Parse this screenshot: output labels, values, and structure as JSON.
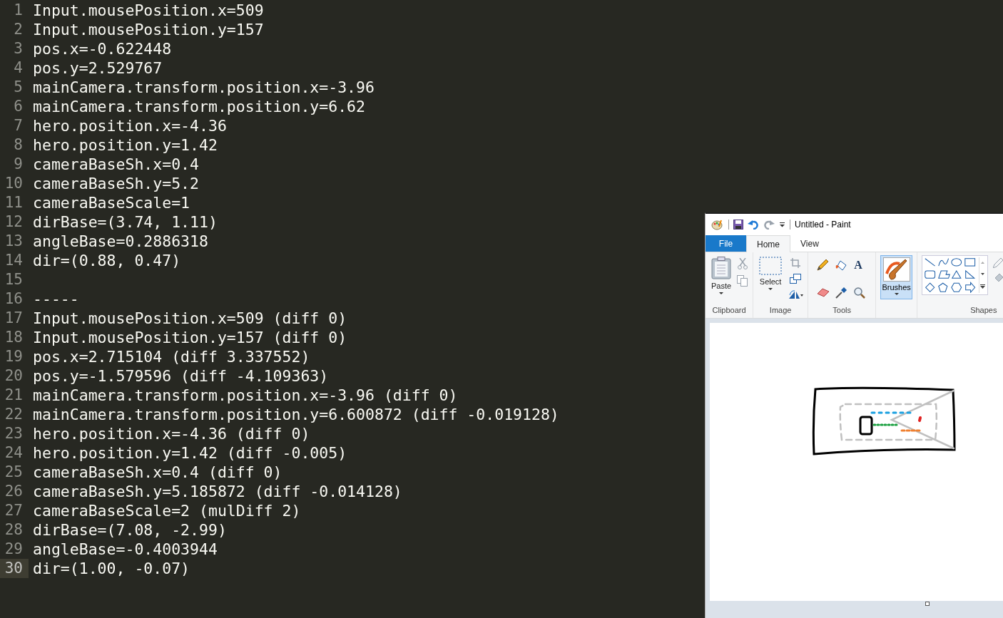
{
  "editor": {
    "lines": [
      {
        "number": "1",
        "text": "Input.mousePosition.x=509",
        "current": false
      },
      {
        "number": "2",
        "text": "Input.mousePosition.y=157",
        "current": false
      },
      {
        "number": "3",
        "text": "pos.x=-0.622448",
        "current": false
      },
      {
        "number": "4",
        "text": "pos.y=2.529767",
        "current": false
      },
      {
        "number": "5",
        "text": "mainCamera.transform.position.x=-3.96",
        "current": false
      },
      {
        "number": "6",
        "text": "mainCamera.transform.position.y=6.62",
        "current": false
      },
      {
        "number": "7",
        "text": "hero.position.x=-4.36",
        "current": false
      },
      {
        "number": "8",
        "text": "hero.position.y=1.42",
        "current": false
      },
      {
        "number": "9",
        "text": "cameraBaseSh.x=0.4",
        "current": false
      },
      {
        "number": "10",
        "text": "cameraBaseSh.y=5.2",
        "current": false
      },
      {
        "number": "11",
        "text": "cameraBaseScale=1",
        "current": false
      },
      {
        "number": "12",
        "text": "dirBase=(3.74, 1.11)",
        "current": false
      },
      {
        "number": "13",
        "text": "angleBase=0.2886318",
        "current": false
      },
      {
        "number": "14",
        "text": "dir=(0.88, 0.47)",
        "current": false
      },
      {
        "number": "15",
        "current": false
      },
      {
        "number": "16",
        "text": "-----",
        "current": false
      },
      {
        "number": "17",
        "text": "Input.mousePosition.x=509 (diff 0)",
        "current": false
      },
      {
        "number": "18",
        "text": "Input.mousePosition.y=157 (diff 0)",
        "current": false
      },
      {
        "number": "19",
        "text": "pos.x=2.715104 (diff 3.337552)",
        "current": false
      },
      {
        "number": "20",
        "text": "pos.y=-1.579596 (diff -4.109363)",
        "current": false
      },
      {
        "number": "21",
        "text": "mainCamera.transform.position.x=-3.96 (diff 0)",
        "current": false
      },
      {
        "number": "22",
        "text": "mainCamera.transform.position.y=6.600872 (diff -0.019128)",
        "current": false
      },
      {
        "number": "23",
        "text": "hero.position.x=-4.36 (diff 0)",
        "current": false
      },
      {
        "number": "24",
        "text": "hero.position.y=1.42 (diff -0.005)",
        "current": false
      },
      {
        "number": "25",
        "text": "cameraBaseSh.x=0.4 (diff 0)",
        "current": false
      },
      {
        "number": "26",
        "text": "cameraBaseSh.y=5.185872 (diff -0.014128)",
        "current": false
      },
      {
        "number": "27",
        "text": "cameraBaseScale=2 (mulDiff 2)",
        "current": false
      },
      {
        "number": "28",
        "text": "dirBase=(7.08, -2.99)",
        "current": false
      },
      {
        "number": "29",
        "text": "angleBase=-0.4003944",
        "current": false
      },
      {
        "number": "30",
        "text": "dir=(1.00, -0.07)",
        "current": true
      }
    ]
  },
  "paint_window": {
    "title": "Untitled - Paint",
    "file_button": "File",
    "tabs": [
      {
        "label": "Home",
        "selected": true
      },
      {
        "label": "View",
        "selected": false
      }
    ],
    "ribbon": {
      "paste": "Paste",
      "select": "Select",
      "text_tool": "A",
      "brushes": {
        "label": "Brushes",
        "selected": true
      },
      "groups": [
        "Clipboard",
        "Image",
        "Tools",
        "Shapes"
      ]
    }
  }
}
